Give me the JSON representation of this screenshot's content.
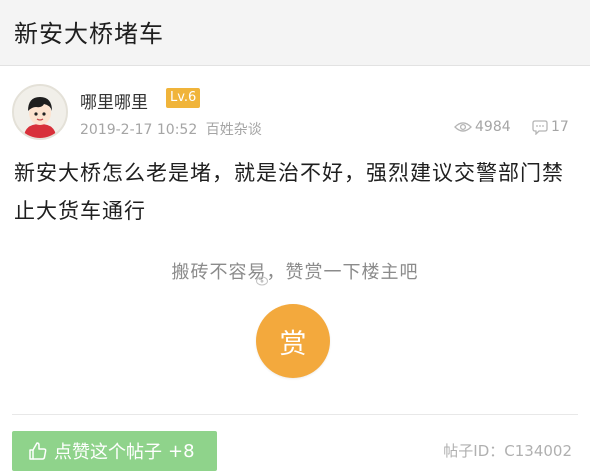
{
  "header": {
    "title": "新安大桥堵车"
  },
  "post": {
    "author": {
      "name": "哪里哪里",
      "level": "Lv.6",
      "avatar_icon": "avatar-boy-icon"
    },
    "date": "2019-2-17 10:52",
    "forum": "百姓杂谈",
    "views": "4984",
    "replies": "17",
    "body": "新安大桥怎么老是堵，就是治不好，强烈建议交警部门禁止大货车通行"
  },
  "reward": {
    "prompt": "搬砖不容易，赞赏一下楼主吧",
    "button_label": "赏",
    "button_color": "#f3a93d"
  },
  "footer": {
    "like_label": "点赞这个帖子",
    "like_count": "+8",
    "like_color": "#8fd38b",
    "post_id": "帖子ID：C134002"
  },
  "colors": {
    "level_badge": "#f0b43a",
    "meta_text": "#a5a5a5",
    "title_bar": "#f4f4f4"
  }
}
